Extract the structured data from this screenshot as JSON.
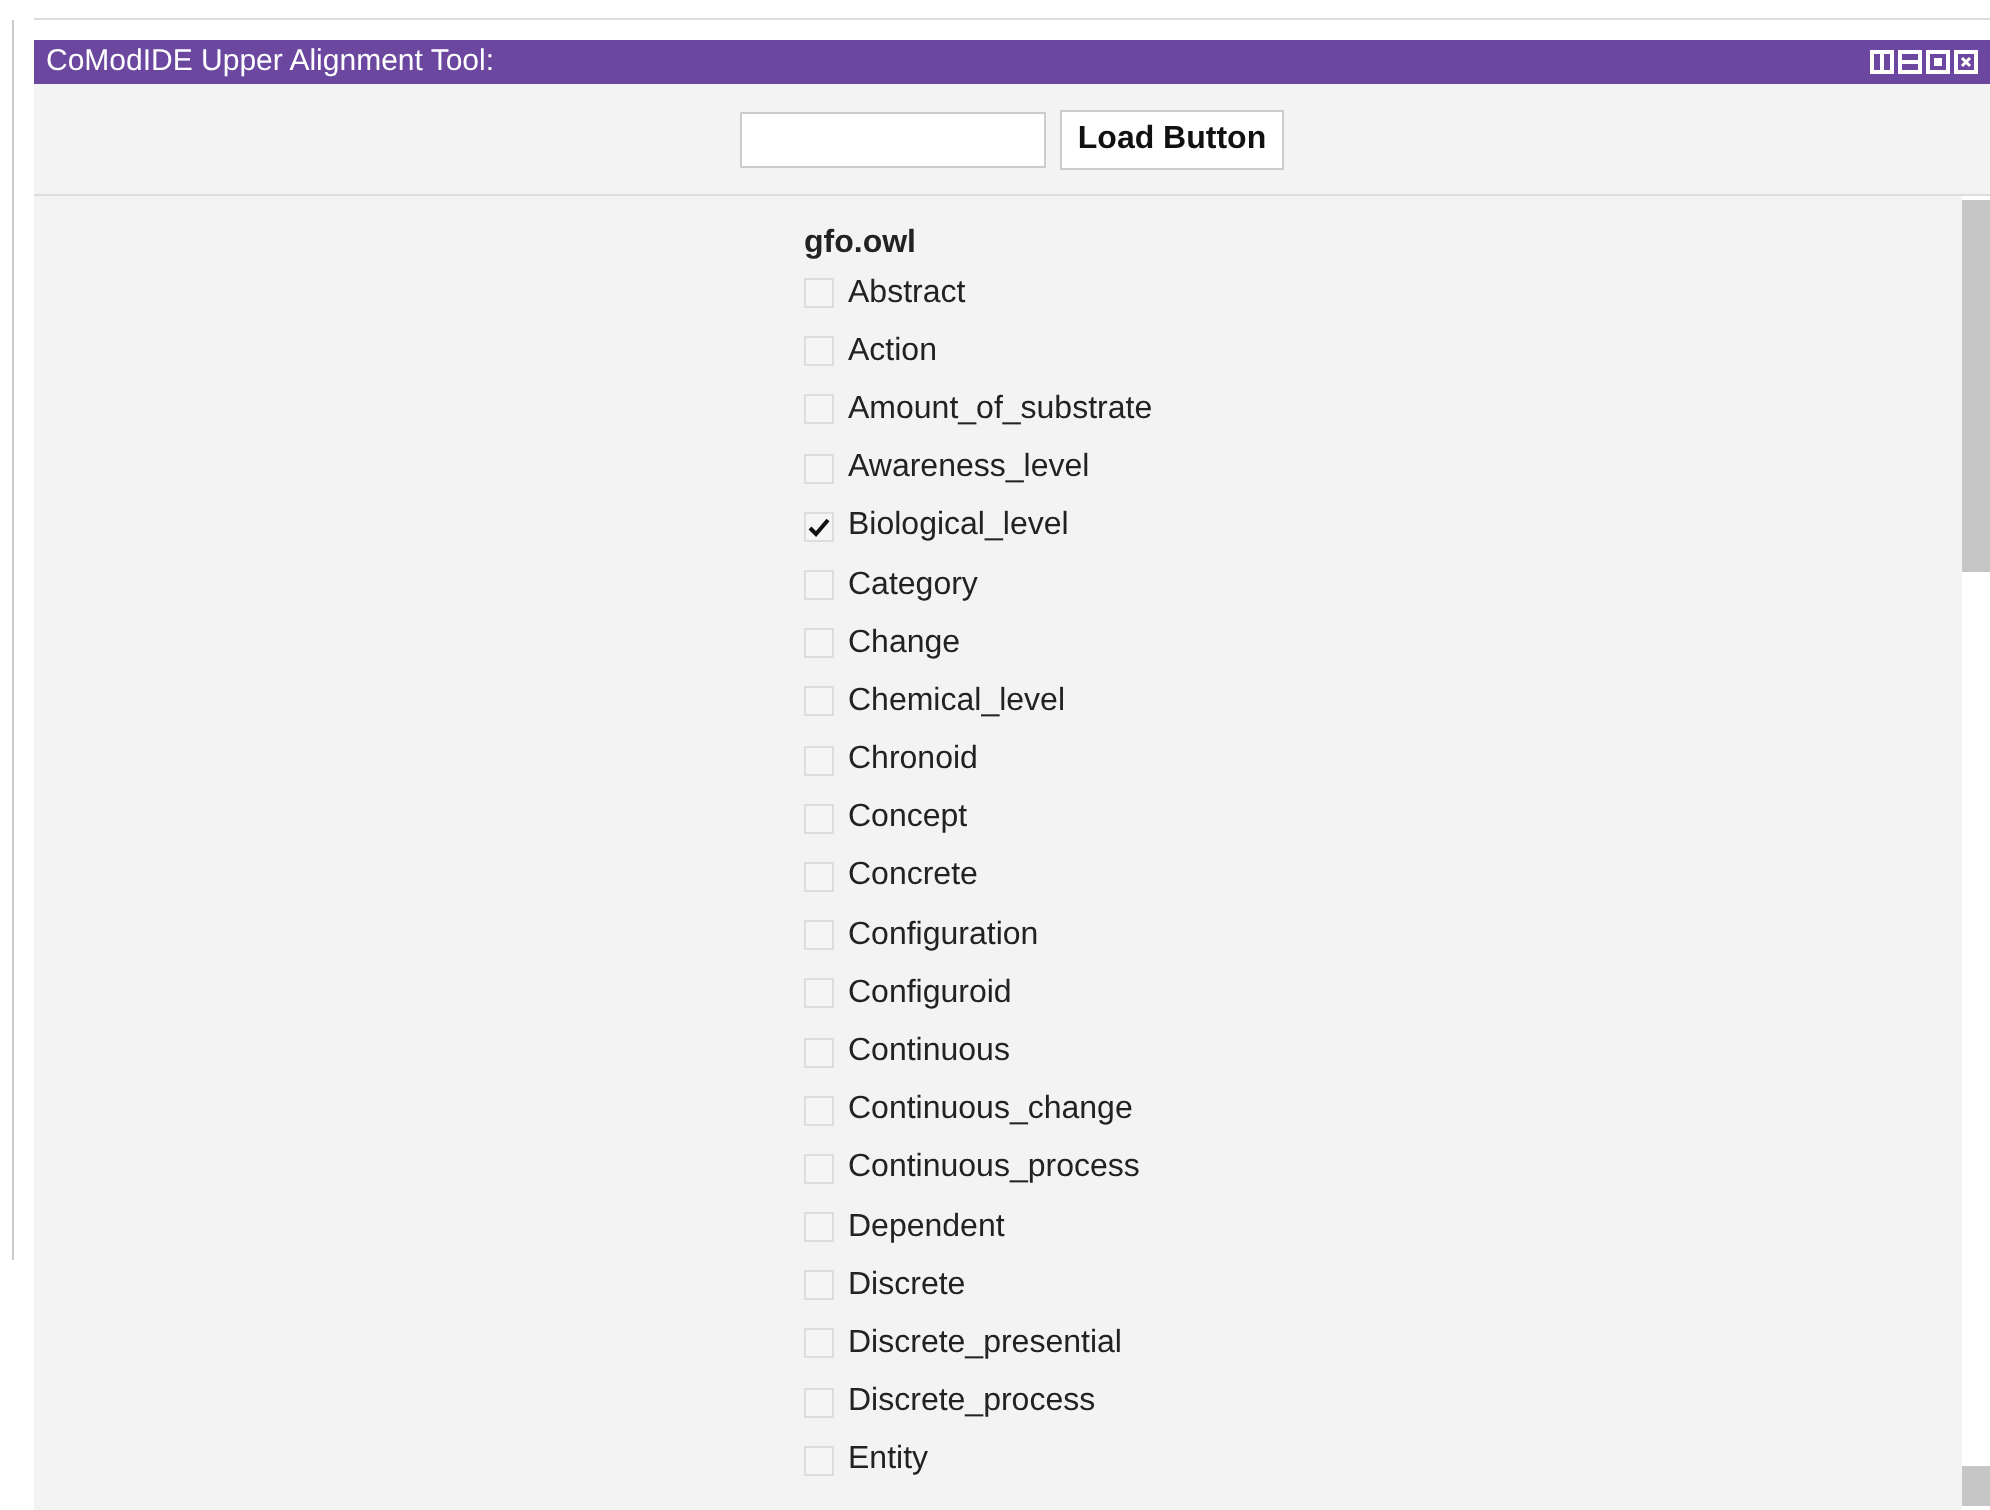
{
  "panel": {
    "title": "CoModIDE Upper Alignment Tool:"
  },
  "loader": {
    "button": "Load Button"
  },
  "ontology": {
    "name": "gfo.owl",
    "classes": [
      {
        "label": "Abstract",
        "checked": false
      },
      {
        "label": "Action",
        "checked": false
      },
      {
        "label": "Amount_of_substrate",
        "checked": false
      },
      {
        "label": "Awareness_level",
        "checked": false
      },
      {
        "label": "Biological_level",
        "checked": true
      },
      {
        "label": "Category",
        "checked": false
      },
      {
        "label": "Change",
        "checked": false
      },
      {
        "label": "Chemical_level",
        "checked": false
      },
      {
        "label": "Chronoid",
        "checked": false
      },
      {
        "label": "Concept",
        "checked": false
      },
      {
        "label": "Concrete",
        "checked": false
      },
      {
        "label": "Configuration",
        "checked": false
      },
      {
        "label": "Configuroid",
        "checked": false
      },
      {
        "label": "Continuous",
        "checked": false
      },
      {
        "label": "Continuous_change",
        "checked": false
      },
      {
        "label": "Continuous_process",
        "checked": false
      },
      {
        "label": "Dependent",
        "checked": false
      },
      {
        "label": "Discrete",
        "checked": false
      },
      {
        "label": "Discrete_presential",
        "checked": false
      },
      {
        "label": "Discrete_process",
        "checked": false
      },
      {
        "label": "Entity",
        "checked": false
      }
    ]
  }
}
